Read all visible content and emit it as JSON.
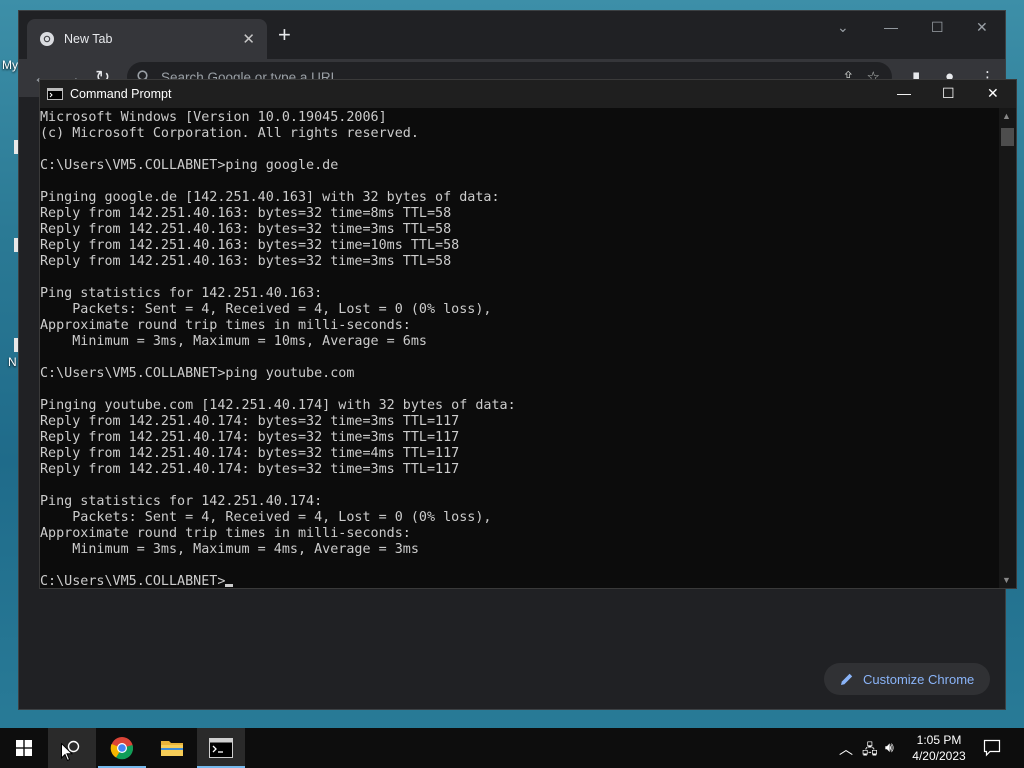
{
  "desktop": {
    "fragment_1": "My",
    "fragment_2": "N"
  },
  "chrome": {
    "tab_title": "New Tab",
    "omnibox_placeholder": "Search Google or type a URL",
    "customize_label": "Customize Chrome"
  },
  "cmd": {
    "title": "Command Prompt",
    "lines": [
      "Microsoft Windows [Version 10.0.19045.2006]",
      "(c) Microsoft Corporation. All rights reserved.",
      "",
      "C:\\Users\\VM5.COLLABNET>ping google.de",
      "",
      "Pinging google.de [142.251.40.163] with 32 bytes of data:",
      "Reply from 142.251.40.163: bytes=32 time=8ms TTL=58",
      "Reply from 142.251.40.163: bytes=32 time=3ms TTL=58",
      "Reply from 142.251.40.163: bytes=32 time=10ms TTL=58",
      "Reply from 142.251.40.163: bytes=32 time=3ms TTL=58",
      "",
      "Ping statistics for 142.251.40.163:",
      "    Packets: Sent = 4, Received = 4, Lost = 0 (0% loss),",
      "Approximate round trip times in milli-seconds:",
      "    Minimum = 3ms, Maximum = 10ms, Average = 6ms",
      "",
      "C:\\Users\\VM5.COLLABNET>ping youtube.com",
      "",
      "Pinging youtube.com [142.251.40.174] with 32 bytes of data:",
      "Reply from 142.251.40.174: bytes=32 time=3ms TTL=117",
      "Reply from 142.251.40.174: bytes=32 time=3ms TTL=117",
      "Reply from 142.251.40.174: bytes=32 time=4ms TTL=117",
      "Reply from 142.251.40.174: bytes=32 time=3ms TTL=117",
      "",
      "Ping statistics for 142.251.40.174:",
      "    Packets: Sent = 4, Received = 4, Lost = 0 (0% loss),",
      "Approximate round trip times in milli-seconds:",
      "    Minimum = 3ms, Maximum = 4ms, Average = 3ms",
      "",
      "C:\\Users\\VM5.COLLABNET>"
    ]
  },
  "taskbar": {
    "time": "1:05 PM",
    "date": "4/20/2023",
    "items": [
      "windows-start-icon",
      "search-icon",
      "chrome-icon",
      "file-explorer-icon",
      "command-prompt-icon"
    ]
  },
  "colors": {
    "terminal_bg": "#0c0c0c",
    "terminal_fg": "#cccccc",
    "chrome_accent": "#8ab4f8"
  }
}
